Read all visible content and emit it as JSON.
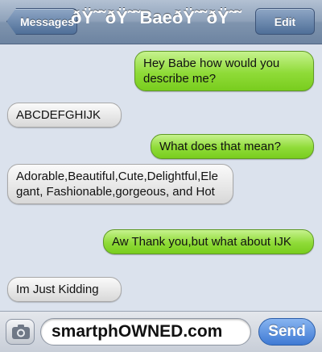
{
  "header": {
    "back_label": "Messages",
    "title": "ðŸ˜˜ðŸ˜˜BaeðŸ˜˜ðŸ˜˜",
    "edit_label": "Edit"
  },
  "messages": [
    {
      "direction": "sent",
      "text": "Hey Babe how would you describe me?"
    },
    {
      "direction": "received",
      "text": "ABCDEFGHIJK"
    },
    {
      "direction": "sent",
      "text": "What does that mean?"
    },
    {
      "direction": "received",
      "text": "Adorable,Beautiful,Cute,Delightful,Elegant, Fashionable,gorgeous, and Hot"
    },
    {
      "direction": "sent",
      "text": "Aw Thank you,but what about IJK"
    },
    {
      "direction": "received",
      "text": "Im Just Kidding"
    }
  ],
  "composer": {
    "camera_icon": "camera-icon",
    "input_value": "smartphOWNED.com",
    "send_label": "Send"
  },
  "colors": {
    "sent_bubble": "#8fdb38",
    "received_bubble": "#e6e6e6",
    "background": "#dbe2ed",
    "send_button": "#3f7ad4"
  }
}
